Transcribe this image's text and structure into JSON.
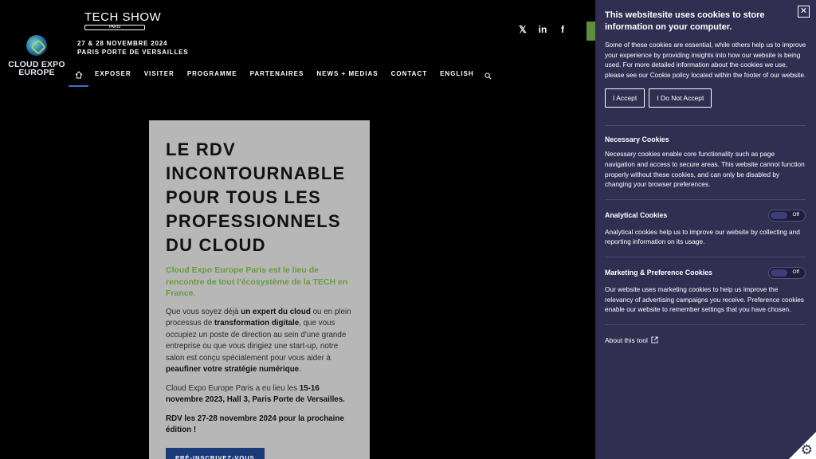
{
  "brand": {
    "logo_line1": "CLOUD EXPO",
    "logo_line2": "EUROPE",
    "techshow_title": "TECH SHOW",
    "techshow_sub": "PARIS",
    "dates": "27 & 28 NOVEMBRE 2024",
    "venue": "PARIS PORTE DE VERSAILLES"
  },
  "nav": {
    "items": [
      "EXPOSER",
      "VISITER",
      "PROGRAMME",
      "PARTENAIRES",
      "NEWS + MEDIAS",
      "CONTACT",
      "ENGLISH"
    ]
  },
  "social": {
    "x": "𝕏",
    "linkedin": "in",
    "facebook": "f"
  },
  "hero": {
    "title_lines": [
      "LE RDV",
      "INCONTOURNABLE",
      "POUR TOUS LES",
      "PROFESSIONNELS",
      "DU CLOUD"
    ],
    "lead": "Cloud Expo Europe Paris est le lieu de rencontre de tout l'écosystème de la TECH en France.",
    "p1_a": "Que vous soyez déjà ",
    "p1_b": "un expert du cloud",
    "p1_c": " ou en plein processus de ",
    "p1_d": "transformation digitale",
    "p1_e": ", que vous occupiez un poste de direction au sein d'une grande entreprise ou que vous dirigiez une start-up, notre salon est conçu spécialement pour vous aider à ",
    "p1_f": "peaufiner votre stratégie numérique",
    "p1_g": ".",
    "p2_a": "Cloud Expo Europe Paris a eu lieu les ",
    "p2_b": "15-16 novembre 2023, Hall 3, Paris Porte de Versailles.",
    "p3": "RDV les 27-28 novembre 2024 pour la prochaine édition !",
    "cta": "PRÉ-INSCRIVEZ-VOUS"
  },
  "cookie": {
    "title": "This websitesite uses cookies to store information on your computer.",
    "intro": "Some of these cookies are essential, while others help us to improve your experience by providing insights into how our website is being used. For more detailed information about the cookies we use, please see our Cookie policy located within the footer of our website.",
    "accept": "I Accept",
    "decline": "I Do Not Accept",
    "necessary_title": "Necessary Cookies",
    "necessary_desc": "Necessary cookies enable core functionality such as page navigation and access to secure areas. This website cannot function properly without these cookies, and can only be disabled by changing your browser preferences.",
    "analytical_title": "Analytical Cookies",
    "analytical_desc": "Analytical cookies help us to improve our website by collecting and reporting information on its usage.",
    "analytical_state": "Off",
    "marketing_title": "Marketing & Preference Cookies",
    "marketing_desc": "Our website uses marketing cookies to help us improve the relevancy of advertising campaigns you receive. Preference cookies enable our website to remember settings that you have chosen.",
    "marketing_state": "Off",
    "about": "About this tool"
  },
  "colors": {
    "accent_green": "#6a9b3e",
    "panel": "#302f52",
    "cta": "#1b3a7a"
  },
  "icons": [
    "home-icon",
    "search-icon",
    "x-icon",
    "linkedin-icon",
    "facebook-icon",
    "close-icon",
    "external-link-icon",
    "gear-icon"
  ]
}
